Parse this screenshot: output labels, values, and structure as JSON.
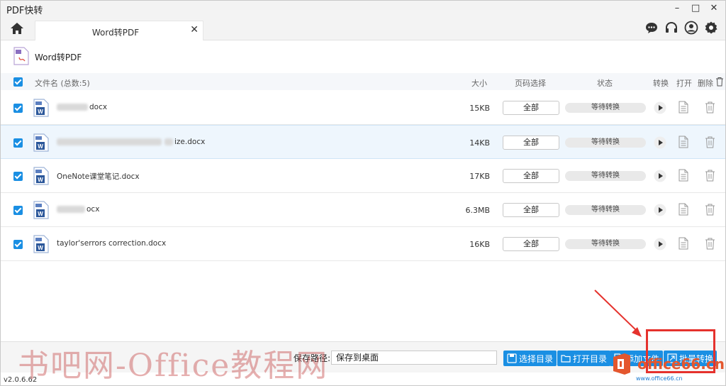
{
  "window": {
    "title": "PDF快转",
    "controls": [
      "–",
      "□",
      "✕"
    ]
  },
  "tabs": [
    {
      "label": "Word转PDF",
      "close": "✕"
    }
  ],
  "page": {
    "title": "Word转PDF"
  },
  "table": {
    "headers": {
      "filename": "文件名 (总数:5)",
      "size": "大小",
      "page_select": "页码选择",
      "status": "状态",
      "convert": "转换",
      "open": "打开",
      "delete": "删除"
    },
    "rows": [
      {
        "name": "docx",
        "size": "15KB",
        "pages": "全部",
        "status": "等待转换"
      },
      {
        "name": "ize.docx",
        "size": "14KB",
        "pages": "全部",
        "status": "等待转换"
      },
      {
        "name": "OneNote课堂笔记.docx",
        "size": "17KB",
        "pages": "全部",
        "status": "等待转换"
      },
      {
        "name": "ocx",
        "size": "6.3MB",
        "pages": "全部",
        "status": "等待转换"
      },
      {
        "name": "taylor'serrors correction.docx",
        "size": "16KB",
        "pages": "全部",
        "status": "等待转换"
      }
    ]
  },
  "footer": {
    "save_path_label": "保存路径:",
    "save_path_value": "保存到桌面",
    "buttons": {
      "choose_dir": "选择目录",
      "open_dir": "打开目录",
      "add_file": "添加文件",
      "batch_convert": "批量转换"
    }
  },
  "version": "v2.0.6.62",
  "overlay": {
    "watermark": "书吧网-Office教程网",
    "brand": "office66.cn",
    "brand_sub": "www.office66.cn",
    "annotation_color": "#e5322d"
  },
  "colors": {
    "accent": "#1a8fe3",
    "word_icon": "#2b579a"
  }
}
